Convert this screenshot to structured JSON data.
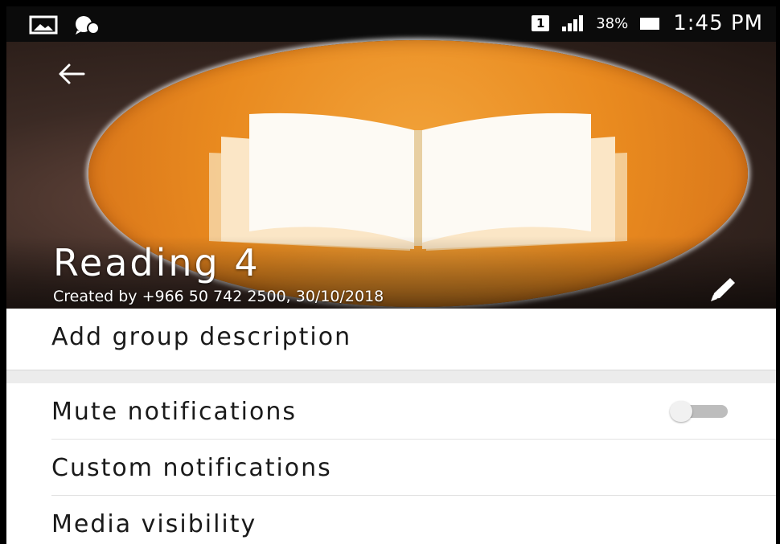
{
  "status_bar": {
    "sim_slot": "1",
    "battery_percent": "38%",
    "time": "1:45 PM",
    "left_icons": [
      "picture-icon",
      "whatsapp-icon"
    ]
  },
  "group": {
    "name": "Reading 4",
    "created_by": "Created by +966 50 742 2500, 30/10/2018",
    "icon": "open-book"
  },
  "actions": {
    "back_icon": "arrow-left-icon",
    "edit_icon": "pencil-icon"
  },
  "settings": {
    "description_label": "Add group description",
    "mute_label": "Mute notifications",
    "mute_enabled": false,
    "custom_label": "Custom notifications",
    "media_label": "Media visibility"
  }
}
